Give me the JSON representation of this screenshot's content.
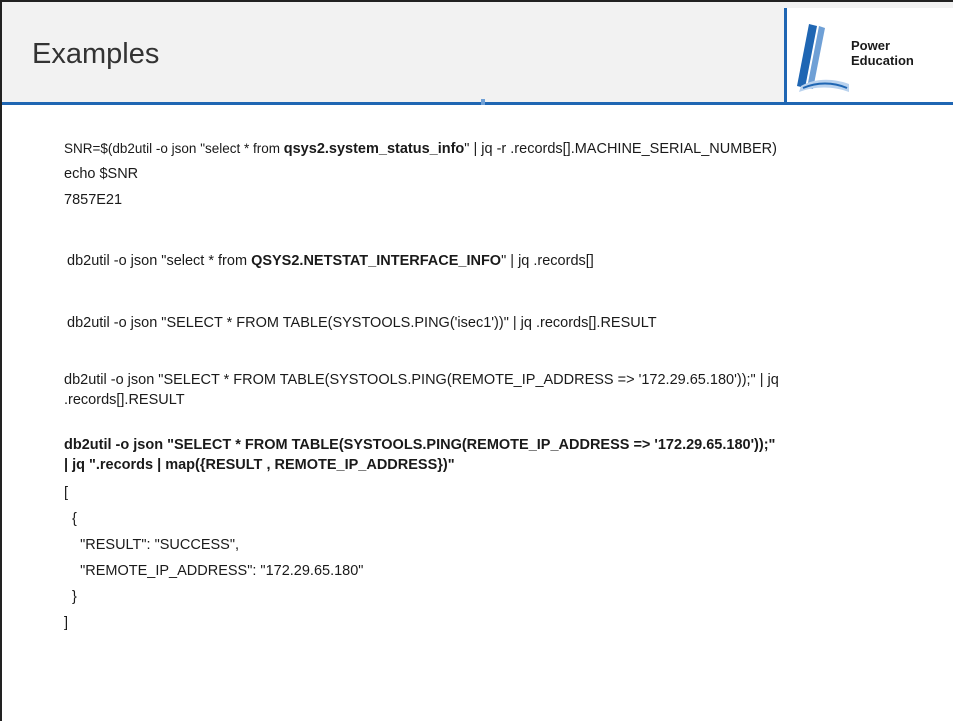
{
  "header": {
    "title": "Examples",
    "logo": {
      "line1": "Power",
      "line2": "Education",
      "icon": "power-education-book-icon",
      "colors": {
        "primary": "#1f66b3",
        "light": "#6fa0d6",
        "pale": "#b9d2ee"
      }
    }
  },
  "content": {
    "snr": {
      "prefix": "SNR=$(db2util -o json \"select * from ",
      "table": "qsys2.system_status_info",
      "suffix": "\" | jq -r .records[].MACHINE_SERIAL_NUMBER)"
    },
    "echo": "echo $SNR",
    "serial": "7857E21",
    "netstat": {
      "prefix": "db2util -o json \"select * from ",
      "table": "QSYS2.NETSTAT_INTERFACE_INFO",
      "suffix": "\" | jq .records[]"
    },
    "ping_isec1": "db2util -o json \"SELECT * FROM TABLE(SYSTOOLS.PING('isec1'))\" | jq .records[].RESULT",
    "ping_ip_line1": "db2util -o json \"SELECT * FROM TABLE(SYSTOOLS.PING(REMOTE_IP_ADDRESS => '172.29.65.180'));\" | jq",
    "ping_ip_line2": ".records[].RESULT",
    "ping_map_line1": "db2util -o json \"SELECT * FROM TABLE(SYSTOOLS.PING(REMOTE_IP_ADDRESS => '172.29.65.180'));\"",
    "ping_map_line2": "| jq \".records | map({RESULT , REMOTE_IP_ADDRESS})\"",
    "output": [
      "[",
      "  {",
      "    \"RESULT\": \"SUCCESS\",",
      "    \"REMOTE_IP_ADDRESS\": \"172.29.65.180\"",
      "  }",
      "]"
    ]
  }
}
